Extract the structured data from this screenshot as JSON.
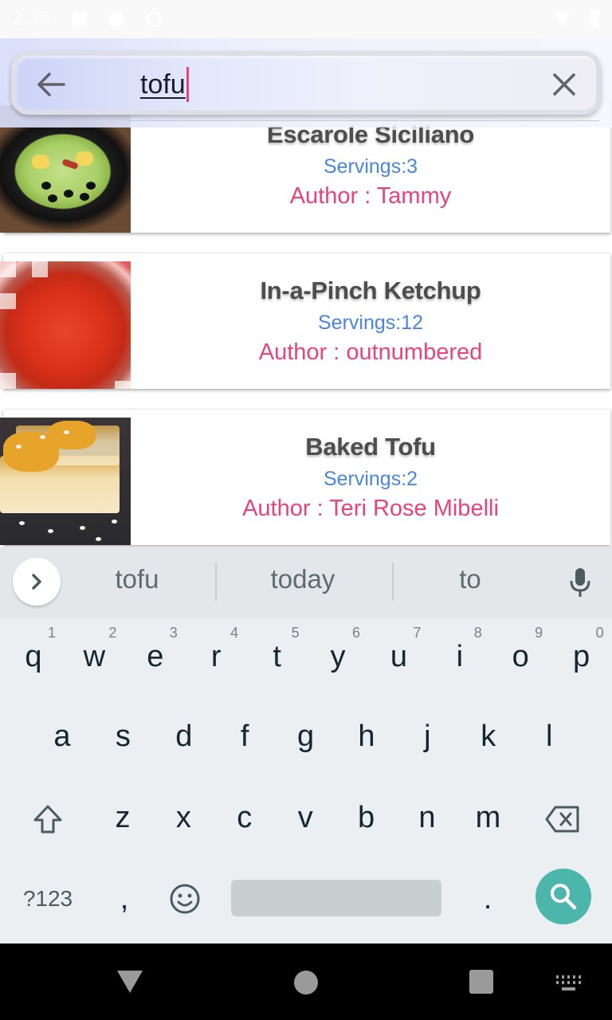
{
  "status_bar": {
    "time": "2:30"
  },
  "search": {
    "query": "tofu",
    "back_icon": "arrow-left-icon",
    "clear_icon": "close-icon"
  },
  "recipes": [
    {
      "title": "Escarole Siciliano",
      "servings": "Servings:3",
      "author": "Author : Tammy",
      "image": "salad"
    },
    {
      "title": "In-a-Pinch Ketchup",
      "servings": "Servings:12",
      "author": "Author : outnumbered",
      "image": "ketchup"
    },
    {
      "title": "Baked Tofu",
      "servings": "Servings:2",
      "author": "Author : Teri Rose Mibelli",
      "image": "tofu"
    }
  ],
  "keyboard": {
    "suggestions": [
      "tofu",
      "today",
      "to"
    ],
    "row1": [
      {
        "key": "q",
        "hint": "1"
      },
      {
        "key": "w",
        "hint": "2"
      },
      {
        "key": "e",
        "hint": "3"
      },
      {
        "key": "r",
        "hint": "4"
      },
      {
        "key": "t",
        "hint": "5"
      },
      {
        "key": "y",
        "hint": "6"
      },
      {
        "key": "u",
        "hint": "7"
      },
      {
        "key": "i",
        "hint": "8"
      },
      {
        "key": "o",
        "hint": "9"
      },
      {
        "key": "p",
        "hint": "0"
      }
    ],
    "row2": [
      "a",
      "s",
      "d",
      "f",
      "g",
      "h",
      "j",
      "k",
      "l"
    ],
    "row3": [
      "z",
      "x",
      "c",
      "v",
      "b",
      "n",
      "m"
    ],
    "symbols_label": "?123",
    "comma": ",",
    "period": "."
  },
  "colors": {
    "title": "#4d4d4d",
    "servings": "#4a86dc",
    "author": "#e8437d",
    "search_key": "#4db6ac",
    "caret": "#e8437d"
  }
}
